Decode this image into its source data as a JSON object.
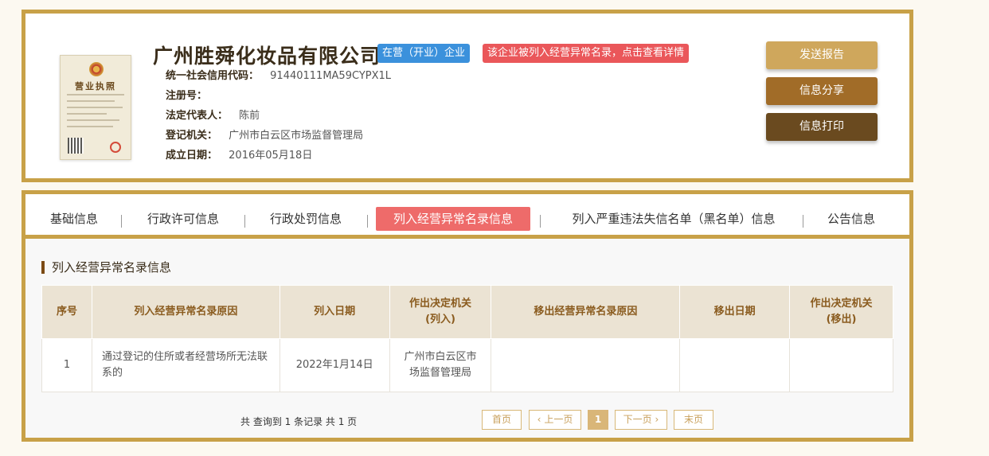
{
  "company": {
    "name": "广州胜舜化妆品有限公司",
    "status_badge": "在营（开业）企业",
    "warning_badge": "该企业被列入经营异常名录，点击查看详情",
    "license_title": "营业执照",
    "fields": [
      {
        "key": "统一社会信用代码：",
        "value": "91440111MA59CYPX1L"
      },
      {
        "key": "注册号：",
        "value": ""
      },
      {
        "key": "法定代表人：",
        "value": "陈前"
      },
      {
        "key": "登记机关：",
        "value": "广州市白云区市场监督管理局"
      },
      {
        "key": "成立日期：",
        "value": "2016年05月18日"
      }
    ]
  },
  "actions": {
    "report": "发送报告",
    "share": "信息分享",
    "print": "信息打印"
  },
  "tabs": [
    {
      "label": "基础信息",
      "active": false
    },
    {
      "label": "行政许可信息",
      "active": false
    },
    {
      "label": "行政处罚信息",
      "active": false
    },
    {
      "label": "列入经营异常名录信息",
      "active": true
    },
    {
      "label": "列入严重违法失信名单（黑名单）信息",
      "active": false
    },
    {
      "label": "公告信息",
      "active": false
    }
  ],
  "section_title": "列入经营异常名录信息",
  "table": {
    "headers": [
      "序号",
      "列入经营异常名录原因",
      "列入日期",
      "作出决定机关\n(列入)",
      "移出经营异常名录原因",
      "移出日期",
      "作出决定机关\n(移出)"
    ],
    "rows": [
      [
        "1",
        "通过登记的住所或者经营场所无法联系的",
        "2022年1月14日",
        "广州市白云区市场监督管理局",
        "",
        "",
        ""
      ]
    ]
  },
  "pager": {
    "summary": "共 查询到 1 条记录 共 1 页",
    "first": "首页",
    "prev": "上一页",
    "current": "1",
    "next": "下一页",
    "last": "末页"
  },
  "colors": {
    "frame": "#c8a148",
    "status_badge": "#3b91dc",
    "warning_badge": "#ea575a",
    "active_tab": "#ee6b6a"
  }
}
